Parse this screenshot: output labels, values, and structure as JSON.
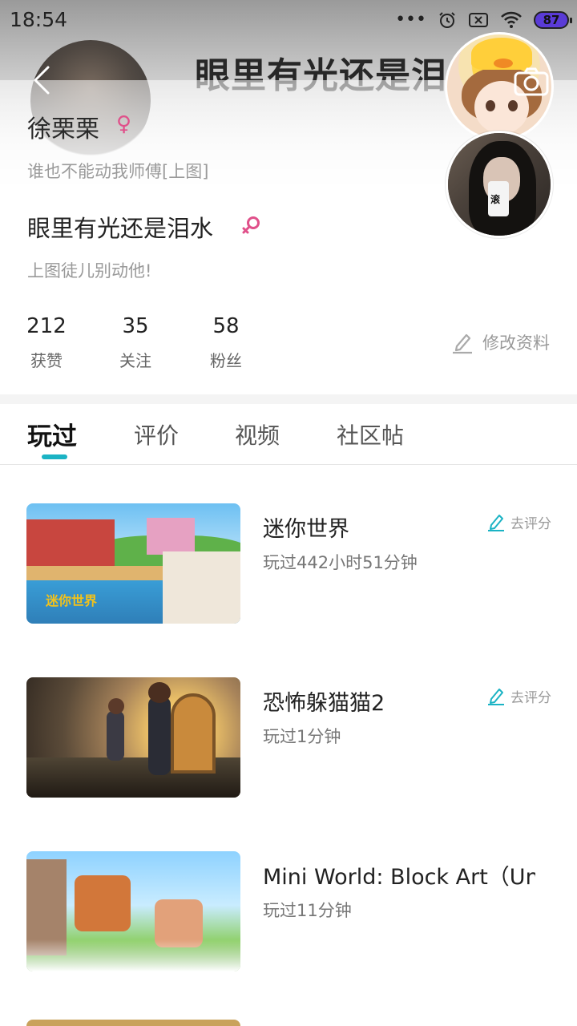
{
  "status_bar": {
    "time": "18:54",
    "battery": "87",
    "dots": "•••"
  },
  "cover": {
    "title": "眼里有光还是泪",
    "name": "徐栗栗",
    "signature": "谁也不能动我师傅[上图]"
  },
  "profile": {
    "name": "眼里有光还是泪水",
    "gender": "female",
    "signature": "上图徒儿别动他!",
    "stats": [
      {
        "value": "212",
        "label": "获赞"
      },
      {
        "value": "35",
        "label": "关注"
      },
      {
        "value": "58",
        "label": "粉丝"
      }
    ],
    "edit_label": "修改资料",
    "avatar_badge_text": "滚"
  },
  "tabs": [
    {
      "label": "玩过",
      "active": true
    },
    {
      "label": "评价",
      "active": false
    },
    {
      "label": "视频",
      "active": false
    },
    {
      "label": "社区帖",
      "active": false
    }
  ],
  "games": [
    {
      "title": "迷你世界",
      "played": "玩过442小时51分钟",
      "rate_label": "去评分",
      "thumb_logo": "迷你世界"
    },
    {
      "title": "恐怖躲猫猫2",
      "played": "玩过1分钟",
      "rate_label": "去评分"
    },
    {
      "title": "Mini World: Block Art（Un...",
      "played": "玩过11分钟"
    }
  ],
  "colors": {
    "accent": "#1bb3c4",
    "female": "#e0508a",
    "text_primary": "#222222",
    "text_secondary": "#999999"
  }
}
